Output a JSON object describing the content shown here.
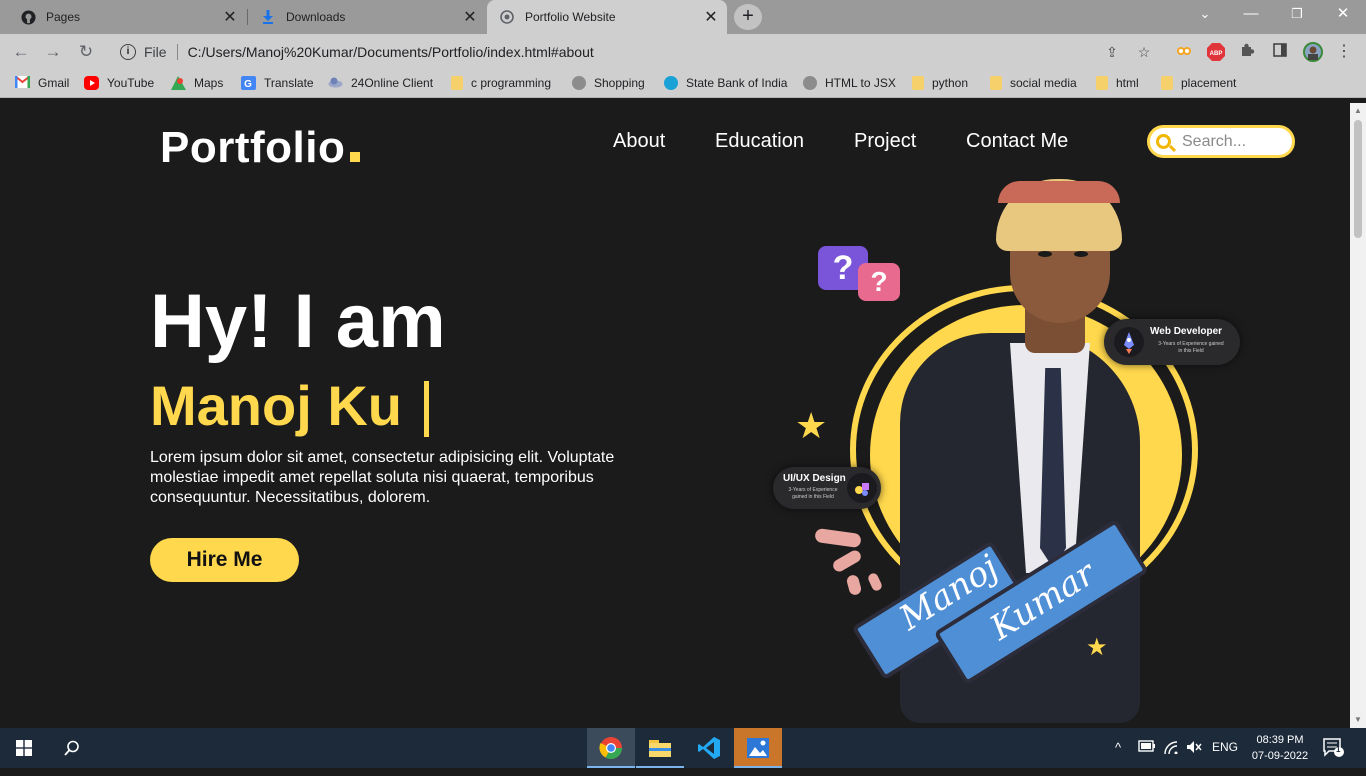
{
  "tabs": [
    {
      "title": "Pages",
      "icon": "github-icon"
    },
    {
      "title": "Downloads",
      "icon": "download-icon"
    },
    {
      "title": "Portfolio Website",
      "icon": "globe-icon"
    }
  ],
  "address": {
    "scheme_label": "File",
    "url": "C:/Users/Manoj%20Kumar/Documents/Portfolio/index.html#about"
  },
  "bookmarks": [
    {
      "label": "Gmail",
      "icon": "gmail-icon"
    },
    {
      "label": "YouTube",
      "icon": "youtube-icon"
    },
    {
      "label": "Maps",
      "icon": "maps-icon"
    },
    {
      "label": "Translate",
      "icon": "translate-icon"
    },
    {
      "label": "24Online Client",
      "icon": "cloud-icon"
    },
    {
      "label": "c programming",
      "icon": "folder-icon"
    },
    {
      "label": "Shopping",
      "icon": "globe-icon"
    },
    {
      "label": "State Bank of India",
      "icon": "sbi-icon"
    },
    {
      "label": "HTML to JSX",
      "icon": "globe-icon"
    },
    {
      "label": "python",
      "icon": "folder-icon"
    },
    {
      "label": "social media",
      "icon": "folder-icon"
    },
    {
      "label": "html",
      "icon": "folder-icon"
    },
    {
      "label": "placement",
      "icon": "folder-icon"
    }
  ],
  "site": {
    "logo": "Portfolio",
    "nav": [
      "About",
      "Education",
      "Project",
      "Contact Me"
    ],
    "search_placeholder": "Search...",
    "greeting": "Hy! I am",
    "typed_name": "Manoj Ku",
    "intro": "Lorem ipsum dolor sit amet, consectetur adipisicing elit. Voluptate molestiae impedit amet repellat soluta nisi quaerat, temporibus consequuntur. Necessitatibus, dolorem.",
    "cta": "Hire Me",
    "badges": [
      {
        "title": "Web Developer",
        "sub": "3-Years of Experience gained in this Field"
      },
      {
        "title": "UI/UX Design",
        "sub": "3-Years of Experience gained in this Field"
      }
    ],
    "banner": [
      "Manoj",
      "Kumar"
    ]
  },
  "taskbar": {
    "language": "ENG",
    "time": "08:39 PM",
    "date": "07-09-2022",
    "notifications": "1"
  },
  "colors": {
    "accent": "#ffd84d",
    "page_bg": "#1b1b1b"
  }
}
